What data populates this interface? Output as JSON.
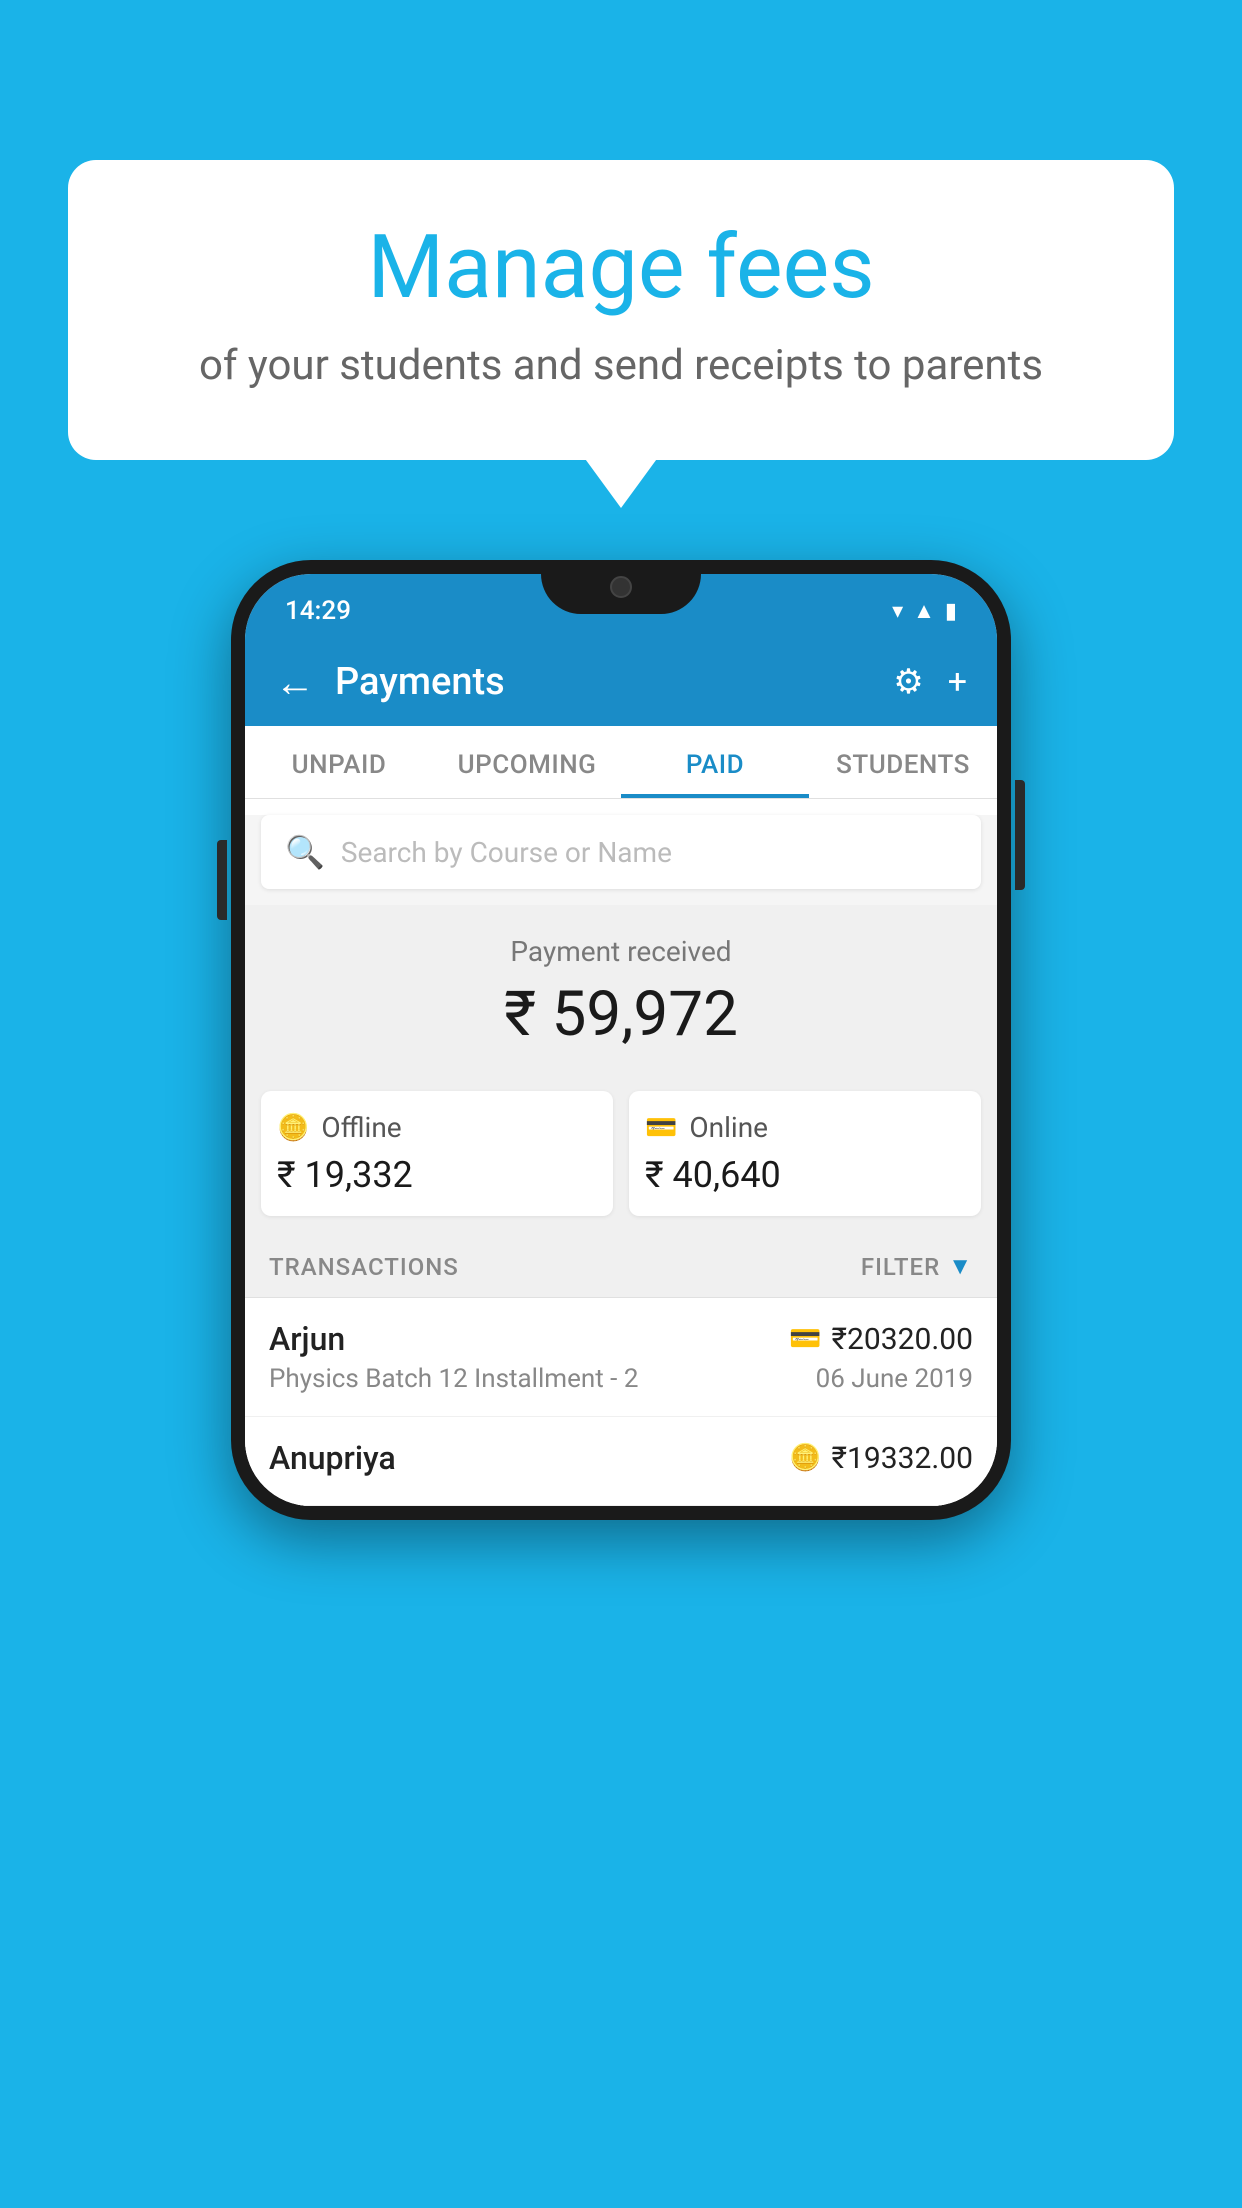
{
  "page": {
    "bg_color": "#1ab3e8"
  },
  "bubble": {
    "title": "Manage fees",
    "subtitle": "of your students and send receipts to parents"
  },
  "phone": {
    "status_bar": {
      "time": "14:29",
      "icons": [
        "wifi",
        "signal",
        "battery"
      ]
    },
    "app_bar": {
      "title": "Payments",
      "back_icon": "←",
      "settings_icon": "⚙",
      "add_icon": "+"
    },
    "tabs": [
      {
        "label": "UNPAID",
        "active": false
      },
      {
        "label": "UPCOMING",
        "active": false
      },
      {
        "label": "PAID",
        "active": true
      },
      {
        "label": "STUDENTS",
        "active": false
      }
    ],
    "search": {
      "placeholder": "Search by Course or Name"
    },
    "payment_received": {
      "label": "Payment received",
      "amount": "₹ 59,972",
      "offline": {
        "label": "Offline",
        "amount": "₹ 19,332"
      },
      "online": {
        "label": "Online",
        "amount": "₹ 40,640"
      }
    },
    "transactions": {
      "section_label": "TRANSACTIONS",
      "filter_label": "FILTER",
      "rows": [
        {
          "name": "Arjun",
          "amount": "₹20320.00",
          "type": "online",
          "course": "Physics Batch 12 Installment - 2",
          "date": "06 June 2019"
        },
        {
          "name": "Anupriya",
          "amount": "₹19332.00",
          "type": "offline",
          "course": "",
          "date": ""
        }
      ]
    }
  }
}
